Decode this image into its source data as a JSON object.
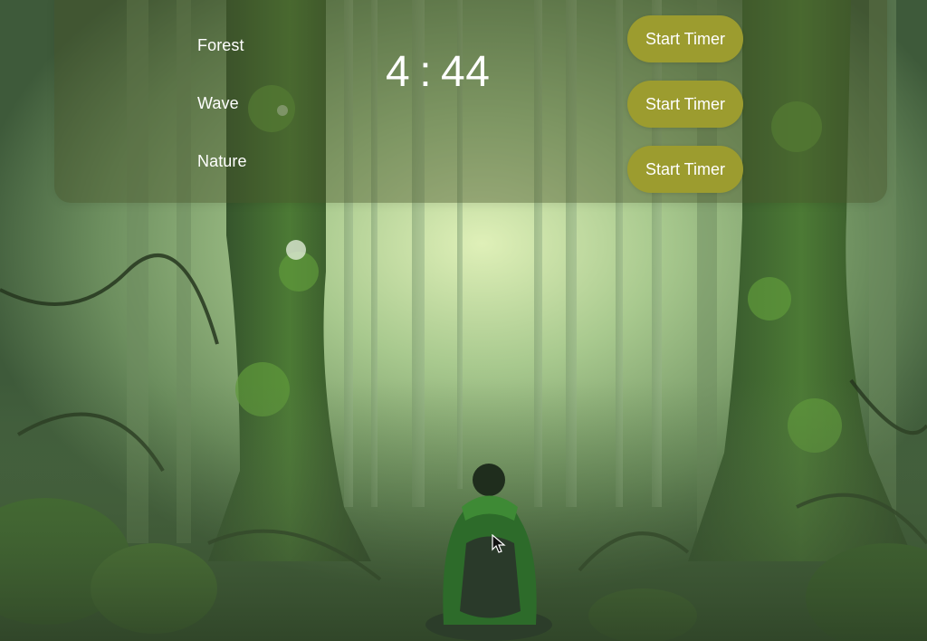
{
  "sounds": [
    "Forest",
    "Wave",
    "Nature"
  ],
  "timer": {
    "minutes": "4",
    "separator": ":",
    "seconds": "44"
  },
  "buttons": [
    "Start Timer",
    "Start Timer",
    "Start Timer"
  ],
  "colors": {
    "button": "#9c9c2f",
    "panel": "rgba(70,80,40,0.42)",
    "text": "#ffffff"
  }
}
